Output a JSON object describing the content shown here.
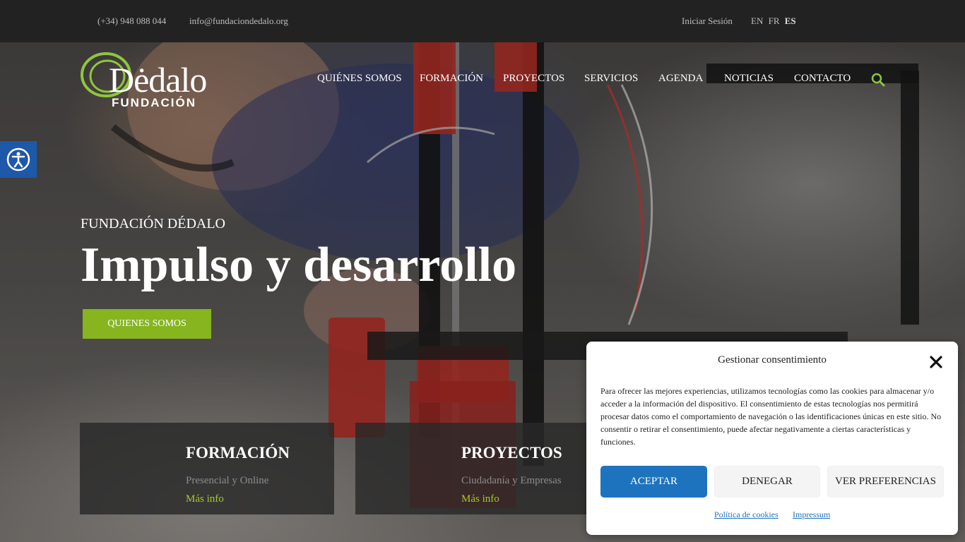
{
  "topbar": {
    "phone": "(+34) 948 088 044",
    "email": "info@fundaciondedalo.org",
    "login": "Iniciar Sesión",
    "languages": [
      "EN",
      "FR",
      "ES"
    ],
    "active_language": "ES"
  },
  "logo": {
    "brand": "Dėdalo",
    "sub": "FUNDACIÓN"
  },
  "nav": {
    "items": [
      "QUIÉNES SOMOS",
      "FORMACIÓN",
      "PROYECTOS",
      "SERVICIOS",
      "AGENDA",
      "NOTICIAS",
      "CONTACTO"
    ],
    "search_icon": "search-icon"
  },
  "hero": {
    "kicker": "FUNDACIÓN DÉDALO",
    "headline": "Impulso y desarrollo",
    "cta": "QUIENES SOMOS"
  },
  "cards": [
    {
      "title": "FORMACIÓN",
      "desc": "Presencial y Online",
      "more": "Más info"
    },
    {
      "title": "PROYECTOS",
      "desc": "Ciudadanía y Empresas",
      "more": "Más info"
    }
  ],
  "consent": {
    "title": "Gestionar consentimiento",
    "body": "Para ofrecer las mejores experiencias, utilizamos tecnologías como las cookies para almacenar y/o acceder a la información del dispositivo. El consentimiento de estas tecnologías nos permitirá procesar datos como el comportamiento de navegación o las identificaciones únicas en este sitio. No consentir o retirar el consentimiento, puede afectar negativamente a ciertas características y funciones.",
    "accept": "ACEPTAR",
    "deny": "DENEGAR",
    "preferences": "VER PREFERENCIAS",
    "cookie_policy": "Política de cookies",
    "impressum": "Impressum"
  },
  "colors": {
    "accent_green": "#86b51f",
    "link_green": "#a6c92a",
    "primary_blue": "#1e73be",
    "topbar_bg": "#222222",
    "a11y_blue": "#1e58a8"
  }
}
